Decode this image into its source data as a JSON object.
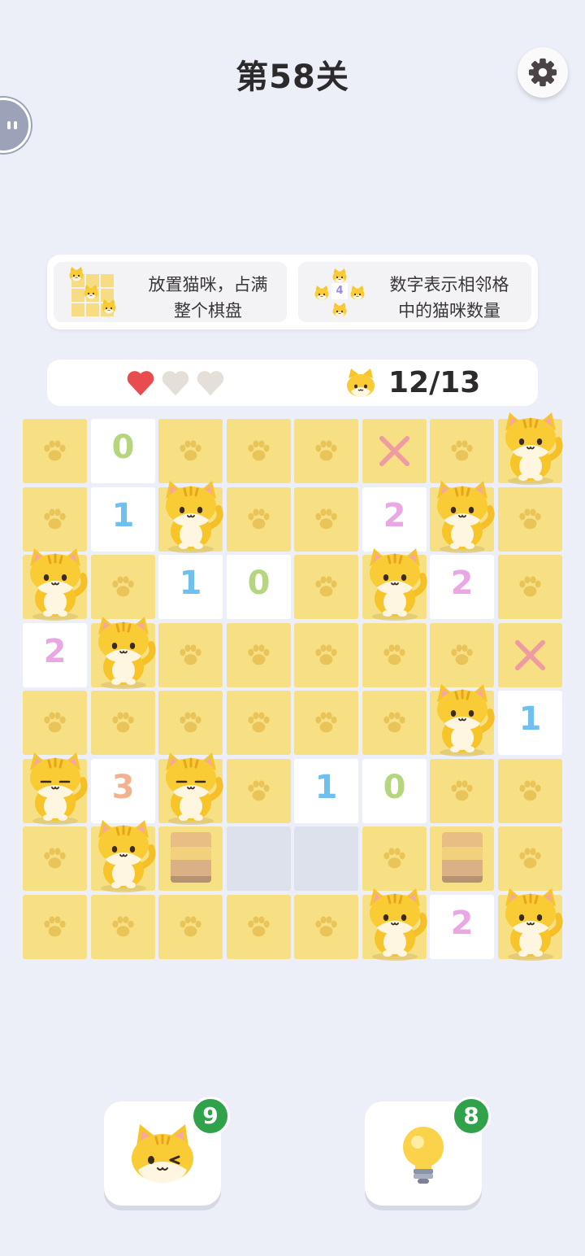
{
  "header": {
    "title": "第58关"
  },
  "hints": [
    {
      "text_line1": "放置猫咪，占满",
      "text_line2": "整个棋盘"
    },
    {
      "text_line1": "数字表示相邻格",
      "text_line2": "中的猫咪数量",
      "example_number": "4"
    }
  ],
  "status": {
    "lives": [
      {
        "state": "full",
        "color": "#E84C4F"
      },
      {
        "state": "empty",
        "color": "#E4DFD8"
      },
      {
        "state": "empty",
        "color": "#E4DFD8"
      }
    ],
    "cats_placed": "12/13"
  },
  "colors": {
    "cell_yellow": "#F7DF84",
    "one": "#6FC0EE",
    "zero": "#B5D67E",
    "two": "#E9A8E4",
    "three": "#F2B28D",
    "x": "#EE9BA1",
    "badge": "#2FA24A"
  },
  "board": {
    "size": 8,
    "rows": [
      [
        "paw",
        "n:0",
        "paw",
        "paw",
        "paw",
        "x",
        "paw",
        "cat"
      ],
      [
        "paw",
        "n:1",
        "cat",
        "paw",
        "paw",
        "n:2",
        "cat",
        "paw"
      ],
      [
        "cat",
        "paw",
        "n:1",
        "n:0",
        "paw",
        "cat",
        "n:2",
        "paw"
      ],
      [
        "n:2",
        "cat",
        "paw",
        "paw",
        "paw",
        "paw",
        "paw",
        "x"
      ],
      [
        "paw",
        "paw",
        "paw",
        "paw",
        "paw",
        "paw",
        "cat",
        "n:1"
      ],
      [
        "cat-sleep",
        "n:3",
        "cat-sleep",
        "paw",
        "n:1",
        "n:0",
        "paw",
        "paw"
      ],
      [
        "paw",
        "cat",
        "block",
        "empty",
        "empty",
        "paw",
        "block",
        "paw"
      ],
      [
        "paw",
        "paw",
        "paw",
        "paw",
        "paw",
        "cat",
        "n:2",
        "cat"
      ]
    ]
  },
  "boosters": [
    {
      "name": "place-cat",
      "icon": "winking-cat-icon",
      "count": "9"
    },
    {
      "name": "hint",
      "icon": "lightbulb-icon",
      "count": "8"
    }
  ]
}
